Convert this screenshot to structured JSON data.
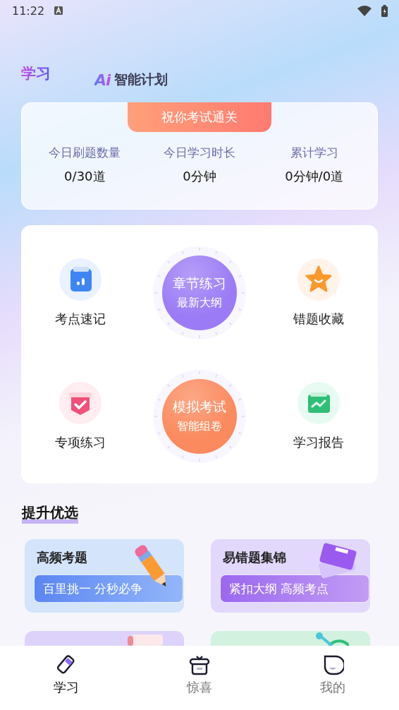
{
  "status_bar": {
    "time": "11:22"
  },
  "header": {
    "title": "学习",
    "plan_logo": "Ai",
    "plan_title": "智能计划"
  },
  "summary": {
    "banner": "祝你考试通关",
    "stats": [
      {
        "label": "今日刷题数量",
        "value": "0/30道"
      },
      {
        "label": "今日学习时长",
        "value": "0分钟"
      },
      {
        "label": "累计学习",
        "value": "0分钟/0道"
      }
    ]
  },
  "features": [
    {
      "left": {
        "label": "考点速记"
      },
      "center": {
        "title": "章节练习",
        "subtitle": "最新大纲",
        "color": "#9b7cf6"
      },
      "right": {
        "label": "错题收藏"
      }
    },
    {
      "left": {
        "label": "专项练习"
      },
      "center": {
        "title": "模拟考试",
        "subtitle": "智能组卷",
        "color": "#fb8a5e"
      },
      "right": {
        "label": "学习报告"
      }
    }
  ],
  "featured": {
    "title": "提升优选",
    "cards": [
      {
        "title": "高频考题",
        "tagline": "百里挑一 分秒必争",
        "color": "#d3e4fb"
      },
      {
        "title": "易错题集锦",
        "tagline": "紧扣大纲 高频考点",
        "color": "#e2d8fb"
      },
      {
        "color": "#ddd3fa"
      },
      {
        "color": "#d2f2df"
      }
    ]
  },
  "tabs": [
    {
      "label": "学习",
      "selected": true
    },
    {
      "label": "惊喜",
      "selected": false
    },
    {
      "label": "我的",
      "selected": false
    }
  ]
}
